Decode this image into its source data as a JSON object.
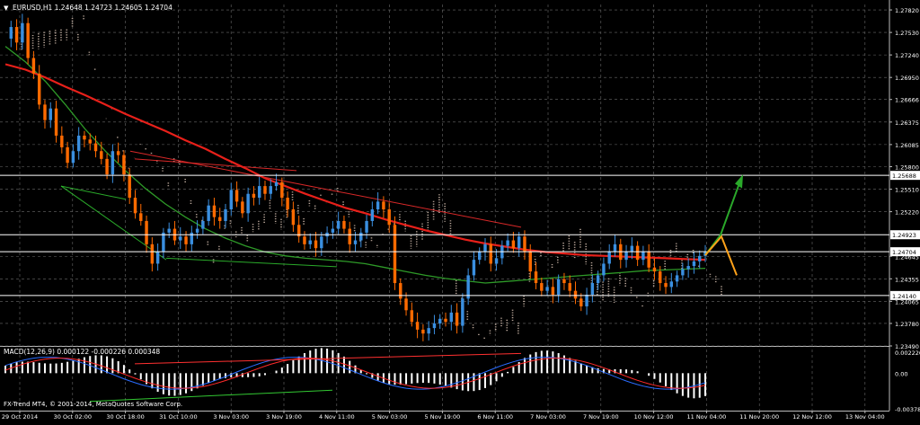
{
  "symbol_header": "EURUSD,H1  1.24648 1.24723 1.24605 1.24704",
  "macd_label": "MACD(12,26,9) 0.000122 -0.000226 0.000348",
  "copyright": "FX-Trend MT4, © 2001-2014, MetaQuotes Software Corp.",
  "colors": {
    "background": "#000000",
    "grid": "#6a6a6a",
    "candle_up": "#3a8fe0",
    "candle_down": "#ff6a00",
    "ma_red": "#e8201a",
    "ma_green": "#2e9a28",
    "cloud": "#e8d0c0",
    "hline": "#ffffff",
    "arrow_green": "#2aa82a",
    "arrow_orange": "#ffa21a",
    "macd_hist": "#ffffff",
    "macd_blue": "#2a6cff",
    "macd_red": "#ff2a2a",
    "trend_green": "#32c832",
    "trend_red": "#ff3030"
  },
  "chart_data": [
    {
      "type": "line",
      "panel": "price",
      "symbol": "EURUSD",
      "timeframe": "H1",
      "ohlc_current": {
        "open": 1.24648,
        "high": 1.24723,
        "low": 1.24605,
        "close": 1.24704
      },
      "y_ticks": [
        "1.27820",
        "1.27530",
        "1.27240",
        "1.26950",
        "1.26666",
        "1.26375",
        "1.26085",
        "1.25800",
        "1.25510",
        "1.25220",
        "1.24645",
        "1.24355",
        "1.24065",
        "1.23780",
        "1.23490"
      ],
      "ylim": [
        1.2349,
        1.2789
      ],
      "price_labels": [
        {
          "price": 1.25688,
          "label": "1.25688"
        },
        {
          "price": 1.24923,
          "label": "1.24923"
        },
        {
          "price": 1.24704,
          "label": "1.24704"
        },
        {
          "price": 1.2414,
          "label": "1.24140"
        }
      ],
      "x_tick_labels": [
        "29 Oct 2014",
        "30 Oct 02:00",
        "30 Oct 18:00",
        "31 Oct 10:00",
        "3 Nov 03:00",
        "3 Nov 19:00",
        "4 Nov 11:00",
        "5 Nov 03:00",
        "5 Nov 19:00",
        "6 Nov 11:00",
        "7 Nov 03:00",
        "7 Nov 19:00",
        "10 Nov 12:00",
        "11 Nov 04:00",
        "11 Nov 20:00",
        "12 Nov 12:00",
        "13 Nov 04:00"
      ],
      "close_path": [
        1.2745,
        1.276,
        1.274,
        1.2765,
        1.272,
        1.27,
        1.266,
        1.264,
        1.2655,
        1.262,
        1.2605,
        1.2585,
        1.26,
        1.262,
        1.2615,
        1.261,
        1.26,
        1.259,
        1.257,
        1.26,
        1.2595,
        1.257,
        1.254,
        1.252,
        1.251,
        1.248,
        1.2455,
        1.247,
        1.2495,
        1.25,
        1.2485,
        1.249,
        1.248,
        1.2495,
        1.25,
        1.251,
        1.253,
        1.2515,
        1.251,
        1.2525,
        1.255,
        1.2535,
        1.252,
        1.2545,
        1.254,
        1.2555,
        1.2545,
        1.2555,
        1.256,
        1.254,
        1.2525,
        1.2505,
        1.249,
        1.248,
        1.2485,
        1.2475,
        1.249,
        1.2495,
        1.25,
        1.251,
        1.25,
        1.248,
        1.2485,
        1.2495,
        1.251,
        1.2525,
        1.2535,
        1.2525,
        1.2505,
        1.243,
        1.241,
        1.2395,
        1.238,
        1.237,
        1.2365,
        1.2372,
        1.2378,
        1.2384,
        1.238,
        1.2392,
        1.2375,
        1.241,
        1.244,
        1.246,
        1.247,
        1.248,
        1.2455,
        1.2462,
        1.2478,
        1.2485,
        1.2475,
        1.249,
        1.247,
        1.2445,
        1.243,
        1.242,
        1.2425,
        1.2415,
        1.2435,
        1.243,
        1.242,
        1.241,
        1.24,
        1.2415,
        1.243,
        1.244,
        1.2455,
        1.247,
        1.248,
        1.246,
        1.247,
        1.2478,
        1.246,
        1.247,
        1.245,
        1.2445,
        1.243,
        1.2425,
        1.2432,
        1.244,
        1.2448,
        1.2452,
        1.2458,
        1.2465,
        1.247
      ],
      "ma_red": [
        1.2712,
        1.2705,
        1.2695,
        1.2683,
        1.2672,
        1.266,
        1.2648,
        1.2637,
        1.2626,
        1.2614,
        1.2603,
        1.259,
        1.2578,
        1.2565,
        1.2555,
        1.2545,
        1.2536,
        1.2527,
        1.252,
        1.2512,
        1.2505,
        1.2498,
        1.2492,
        1.2486,
        1.2481,
        1.2477,
        1.2473,
        1.247,
        1.2468,
        1.2466,
        1.2465,
        1.2464,
        1.2463,
        1.2462,
        1.2461,
        1.246
      ],
      "ma_green": [
        1.2735,
        1.2715,
        1.269,
        1.266,
        1.2628,
        1.26,
        1.2575,
        1.2552,
        1.2532,
        1.2515,
        1.25,
        1.2488,
        1.2478,
        1.247,
        1.2465,
        1.2462,
        1.246,
        1.2458,
        1.2455,
        1.245,
        1.2445,
        1.244,
        1.2436,
        1.2433,
        1.243,
        1.2432,
        1.2434,
        1.2436,
        1.2438,
        1.244,
        1.2442,
        1.2444,
        1.2446,
        1.2447,
        1.2448,
        1.2449
      ]
    },
    {
      "type": "area",
      "panel": "macd",
      "name": "MACD(12,26,9)",
      "values_current": {
        "main": 0.000122,
        "signal": -0.000226,
        "hist": 0.000348
      },
      "y_ticks": [
        "0.002226",
        "0.00",
        "-0.003784"
      ],
      "ylim": [
        -0.003784,
        0.002226
      ]
    }
  ]
}
